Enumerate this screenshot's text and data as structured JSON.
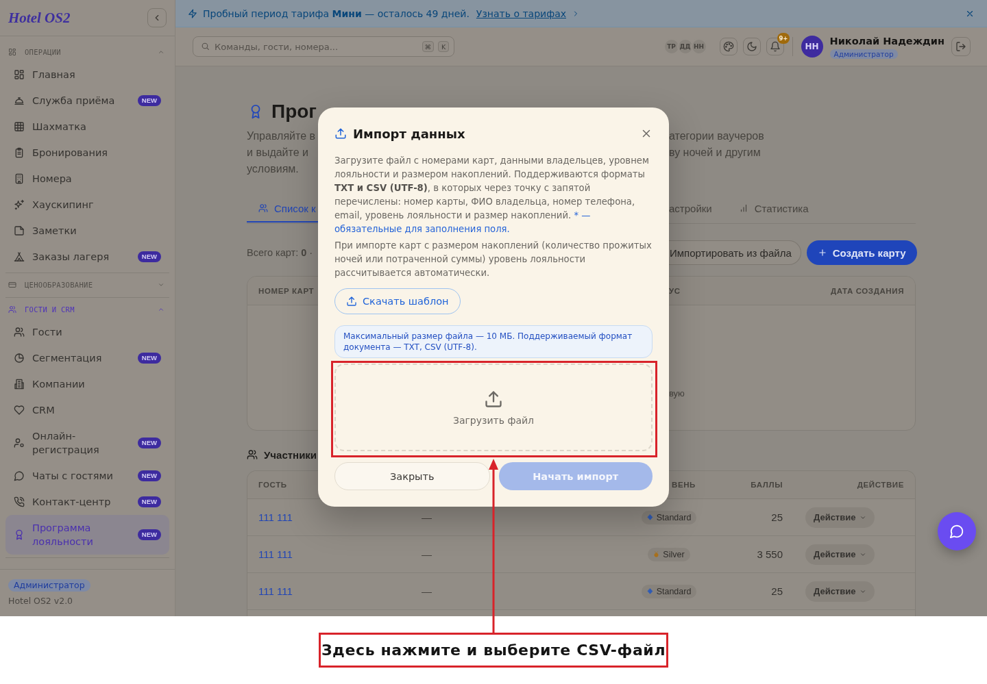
{
  "sidebar": {
    "logo": "Hotel OS2",
    "groups": [
      {
        "title": "ОПЕРАЦИИ",
        "expanded": true,
        "items": [
          {
            "label": "Главная",
            "selected": false
          },
          {
            "label": "Служба приёма",
            "badge": "NEW",
            "selected": false
          },
          {
            "label": "Шахматка",
            "selected": false
          },
          {
            "label": "Бронирования",
            "selected": false
          },
          {
            "label": "Номера",
            "selected": false
          },
          {
            "label": "Хаускипинг",
            "selected": false
          },
          {
            "label": "Заметки",
            "selected": false
          },
          {
            "label": "Заказы лагеря",
            "badge": "NEW",
            "selected": false
          }
        ]
      },
      {
        "title": "ЦЕНООБРАЗОВАНИЕ",
        "expanded": false
      },
      {
        "title": "ГОСТИ И CRM",
        "expanded": true,
        "items": [
          {
            "label": "Гости",
            "selected": false
          },
          {
            "label": "Сегментация",
            "badge": "NEW",
            "selected": false
          },
          {
            "label": "Компании",
            "selected": false
          },
          {
            "label": "CRM",
            "selected": false
          },
          {
            "label": "Онлайн-регистрация",
            "badge": "NEW",
            "selected": false
          },
          {
            "label": "Чаты с гостями",
            "badge": "NEW",
            "selected": false
          },
          {
            "label": "Контакт-центр",
            "badge": "NEW",
            "selected": false
          },
          {
            "label": "Программа лояльности",
            "badge": "NEW",
            "selected": true
          }
        ]
      }
    ],
    "footer": {
      "role": "Администратор",
      "version": "Hotel OS2 v2.0"
    }
  },
  "banner": {
    "text": "Пробный период тарифа **Мини** — осталось 49 дней.",
    "link": "Узнать о тарифах"
  },
  "topbar": {
    "search": {
      "placeholder": "Команды, гости, номера...",
      "shortcut": [
        "⌘",
        "K"
      ]
    },
    "online_users": [
      "ТР",
      "ДД",
      "НН"
    ],
    "notifications": "9+",
    "user": {
      "initials": "НН",
      "name": "Николай Надеждин",
      "role": "Администратор"
    }
  },
  "content": {
    "title": "Прог",
    "description_lines": [
      {
        "left": "Управляйте в",
        "right": "атегории ваучеров"
      },
      {
        "left": "и выдайте и",
        "right": "ву ночей и другим"
      },
      {
        "left": "условиям."
      }
    ],
    "tabs": [
      {
        "label": "Список к",
        "selected": true
      },
      {
        "label": "астройки",
        "selected": false
      },
      {
        "label": "Статистика",
        "selected": false
      }
    ],
    "summary": "Всего карт: **0** ·",
    "actions": [
      {
        "label": "Импортировать из файла",
        "kind": "secondary"
      },
      {
        "label": "Создать карту",
        "kind": "primary"
      }
    ],
    "cards_table": {
      "columns": [
        "НОМЕР КАРТ",
        "УС",
        "ДАТА СОЗДАНИЯ"
      ],
      "empty_text": "вую"
    },
    "members": {
      "title": "Участники",
      "columns": [
        "ГОСТЬ",
        "ВЕНЬ",
        "БАЛЛЫ",
        "ДЕЙСТВИЕ"
      ],
      "rows": [
        {
          "guest": "111 111",
          "column_2": "—",
          "tier": {
            "label": "Standard",
            "kind": "base"
          },
          "points": "25",
          "action": "Действие"
        },
        {
          "guest": "111 111",
          "column_2": "—",
          "tier": {
            "label": "Silver",
            "kind": "award"
          },
          "points": "3 550",
          "action": "Действие"
        },
        {
          "guest": "111 111",
          "column_2": "—",
          "tier": {
            "label": "Standard",
            "kind": "base"
          },
          "points": "25",
          "action": "Действие"
        }
      ]
    }
  },
  "modal": {
    "title": "Импорт данных",
    "description": "Загрузите файл с номерами карт, данными владельцев, уровнем лояльности и размером накоплений. Поддерживаются форматы **TXT и CSV (UTF-8)**, в которых через точку с запятой перечислены: номер карты, ФИО владельца, номер телефона, email, уровень лояльности и размер накоплений.",
    "required_note": "* — обязательные для заполнения поля.",
    "note": "При импорте карт с размером накоплений (количество прожитых ночей или потраченной суммы) уровень лояльности рассчитывается автоматически.",
    "template_button": "Скачать шаблон",
    "limits": "Максимальный размер файла — 10 МБ. Поддерживаемый формат документа — TXT, CSV (UTF-8).",
    "dropzone": "Загрузить файл",
    "buttons": [
      {
        "label": "Закрыть",
        "kind": "secondary",
        "disabled": false
      },
      {
        "label": "Начать импорт",
        "kind": "primary",
        "disabled": true
      }
    ]
  },
  "annotation": {
    "caption": "Здесь нажмите и выберите CSV-файл"
  }
}
